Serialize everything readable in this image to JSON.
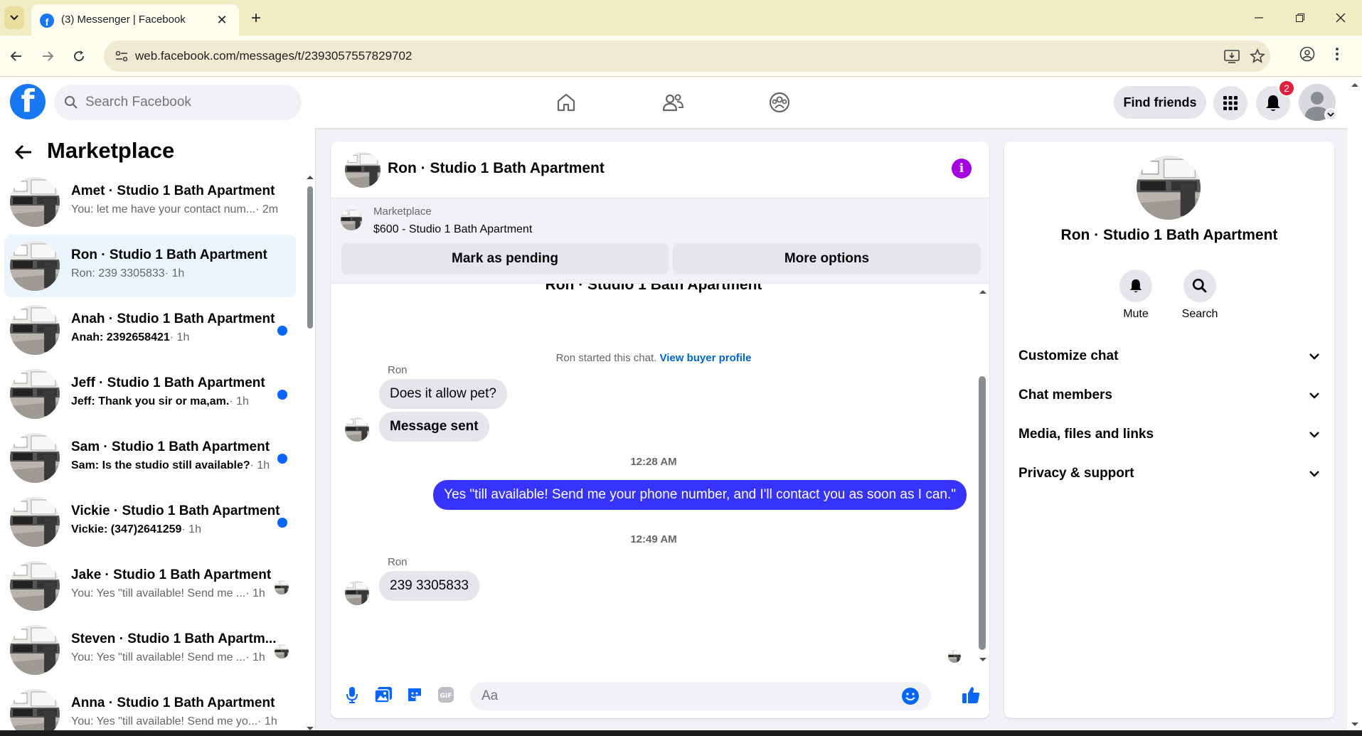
{
  "browser": {
    "tab_title": "(3) Messenger | Facebook",
    "url": "web.facebook.com/messages/t/2393057557829702"
  },
  "fb": {
    "search_placeholder": "Search Facebook",
    "find_friends": "Find friends",
    "notification_count": "2",
    "brand_color": "#1877f2"
  },
  "sidebar": {
    "title": "Marketplace",
    "conversations": [
      {
        "name": "Amet · Studio 1 Bath Apartment",
        "preview": "You: let me have your contact num...",
        "time": "· 2m",
        "status": "none",
        "unread": false
      },
      {
        "name": "Ron · Studio 1 Bath Apartment",
        "preview": "Ron: 239 3305833",
        "time": "· 1h",
        "status": "none",
        "unread": false,
        "active": true
      },
      {
        "name": "Anah · Studio 1 Bath Apartment",
        "preview": "Anah: 2392658421",
        "time": "· 1h",
        "status": "dot",
        "unread": true
      },
      {
        "name": "Jeff · Studio 1 Bath Apartment",
        "preview": "Jeff: Thank you sir or ma,am.",
        "time": "· 1h",
        "status": "dot",
        "unread": true
      },
      {
        "name": "Sam · Studio 1 Bath Apartment",
        "preview": "Sam: Is the studio still available?",
        "time": "· 1h",
        "status": "dot",
        "unread": true
      },
      {
        "name": "Vickie · Studio 1 Bath Apartment",
        "preview": "Vickie: (347)2641259",
        "time": "· 1h",
        "status": "dot",
        "unread": true
      },
      {
        "name": "Jake · Studio 1 Bath Apartment",
        "preview": "You: Yes \"till available! Send me ...",
        "time": "· 1h",
        "status": "seen",
        "unread": false
      },
      {
        "name": "Steven · Studio 1 Bath Apartm...",
        "preview": "You: Yes \"till available! Send me ...",
        "time": "· 1h",
        "status": "seen",
        "unread": false
      },
      {
        "name": "Anna · Studio 1 Bath Apartment",
        "preview": "You: Yes \"till available! Send me yo...",
        "time": "· 1h",
        "status": "none",
        "unread": false
      }
    ]
  },
  "chat": {
    "title": "Ron · Studio 1 Bath Apartment",
    "listing_label": "Marketplace",
    "listing_price": "$600 - Studio 1 Bath Apartment",
    "mark_pending": "Mark as pending",
    "more_options": "More options",
    "header_partial": "Ron · Studio 1 Bath Apartment",
    "started_text": "Ron started this chat.",
    "view_buyer": "View buyer profile",
    "sender1": "Ron",
    "msg1": "Does it allow pet?",
    "msg2": "Message sent",
    "time1": "12:28 AM",
    "msg_out": "Yes \"till available! Send me your phone number, and I'll contact you as soon as I can.\"",
    "time2": "12:49 AM",
    "sender2": "Ron",
    "msg3": "239 3305833",
    "composer_placeholder": "Aa",
    "outgoing_color": "#3733ff"
  },
  "details": {
    "name": "Ron · Studio 1 Bath Apartment",
    "mute": "Mute",
    "search": "Search",
    "sections": [
      "Customize chat",
      "Chat members",
      "Media, files and links",
      "Privacy & support"
    ]
  }
}
